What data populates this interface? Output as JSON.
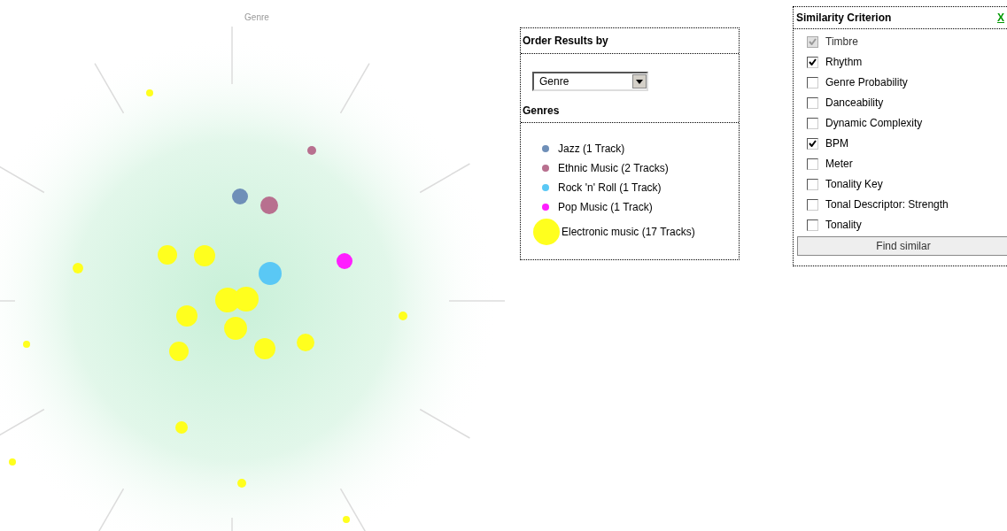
{
  "plot": {
    "axis_label": "Genre"
  },
  "order_panel": {
    "title": "Order Results by",
    "dropdown": {
      "value": "Genre"
    },
    "genres_title": "Genres",
    "genres": [
      {
        "label": "Jazz (1 Track)",
        "color": "#6f8fb8",
        "kind": "small"
      },
      {
        "label": "Ethnic Music (2 Tracks)",
        "color": "#b8708f",
        "kind": "small"
      },
      {
        "label": "Rock 'n' Roll (1 Track)",
        "color": "#5ac8f5",
        "kind": "small"
      },
      {
        "label": "Pop Music (1 Track)",
        "color": "#ff1eff",
        "kind": "small"
      },
      {
        "label": "Electronic music (17 Tracks)",
        "color": "#ffff1e",
        "kind": "large"
      }
    ]
  },
  "similarity_panel": {
    "title": "Similarity Criterion",
    "close": "X",
    "criteria": [
      {
        "label": "Timbre",
        "checked": true,
        "disabled": true
      },
      {
        "label": "Rhythm",
        "checked": true,
        "disabled": false
      },
      {
        "label": "Genre Probability",
        "checked": false,
        "disabled": false
      },
      {
        "label": "Danceability",
        "checked": false,
        "disabled": false
      },
      {
        "label": "Dynamic Complexity",
        "checked": false,
        "disabled": false
      },
      {
        "label": "BPM",
        "checked": true,
        "disabled": false
      },
      {
        "label": "Meter",
        "checked": false,
        "disabled": false
      },
      {
        "label": "Tonality Key",
        "checked": false,
        "disabled": false
      },
      {
        "label": "Tonal Descriptor: Strength",
        "checked": false,
        "disabled": false
      },
      {
        "label": "Tonality",
        "checked": false,
        "disabled": false
      }
    ],
    "button": "Find similar"
  }
}
